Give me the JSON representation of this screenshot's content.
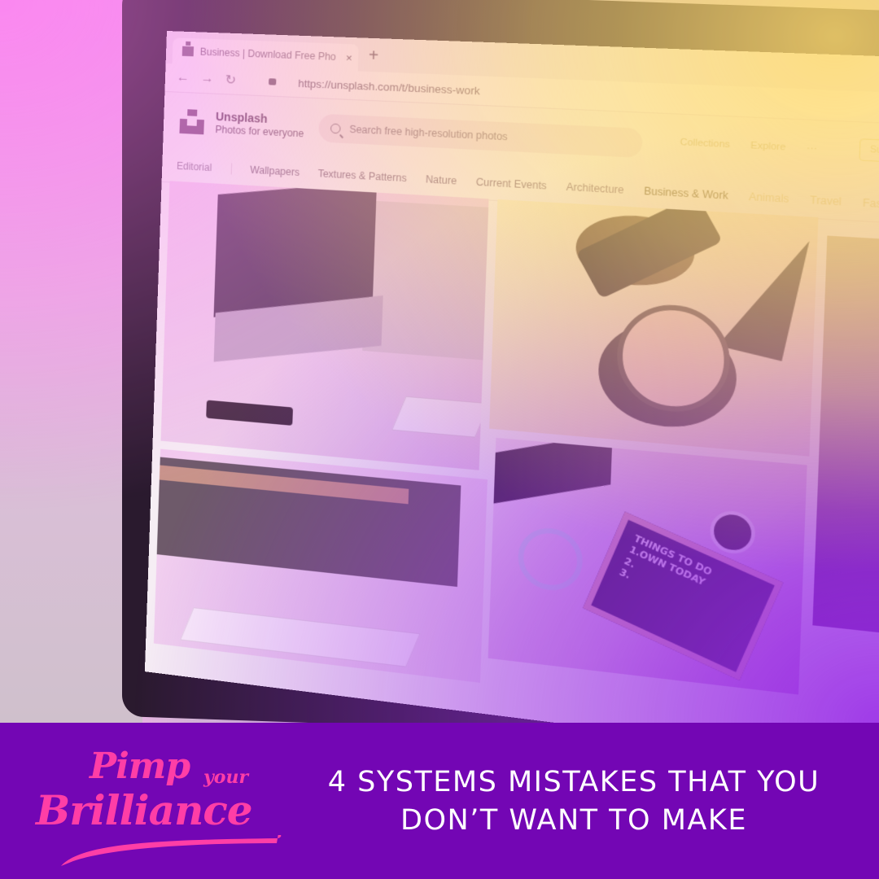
{
  "browser": {
    "tab_title": "Business | Download Free Pho",
    "tab_close": "×",
    "new_tab": "+",
    "back": "←",
    "forward": "→",
    "reload": "↻",
    "url": "https://unsplash.com/t/business-work"
  },
  "site": {
    "name": "Unsplash",
    "tagline": "Photos for everyone",
    "search_placeholder": "Search free high-resolution photos",
    "header_links": [
      "Collections",
      "Explore",
      "···"
    ],
    "submit_label": "Submit a photo",
    "editorial": "Editorial",
    "categories": [
      {
        "label": "Wallpapers",
        "state": "normal"
      },
      {
        "label": "Textures & Patterns",
        "state": "normal"
      },
      {
        "label": "Nature",
        "state": "normal"
      },
      {
        "label": "Current Events",
        "state": "normal"
      },
      {
        "label": "Architecture",
        "state": "normal"
      },
      {
        "label": "Business & Work",
        "state": "active"
      },
      {
        "label": "Animals",
        "state": "faded"
      },
      {
        "label": "Travel",
        "state": "faded"
      },
      {
        "label": "Fashion",
        "state": "faded"
      }
    ],
    "letterboard_text": [
      "THINGS TO DO",
      "1.OWN TODAY",
      "2.",
      "3."
    ]
  },
  "footer": {
    "logo_line1": "Pimp",
    "logo_line1_small": "your",
    "logo_line2": "Brilliance",
    "headline_line1": "4 SYSTEMS MISTAKES THAT YOU",
    "headline_line2": "DON’T WANT TO MAKE"
  },
  "colors": {
    "footer_bg": "#7306b4",
    "logo_pink": "#ff3ea6",
    "headline": "#ffffff"
  }
}
